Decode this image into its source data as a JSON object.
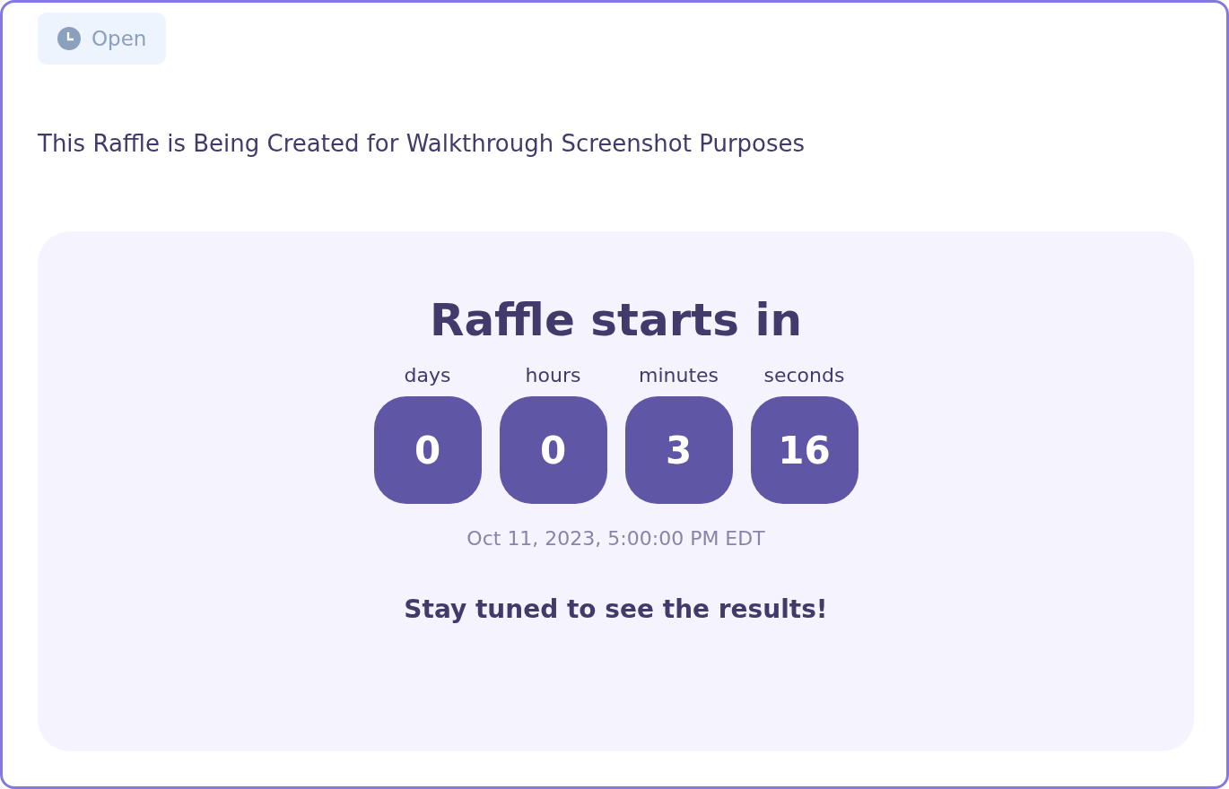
{
  "status_badge": {
    "label": "Open"
  },
  "title": "This Raffle is Being Created for Walkthrough Screenshot Purposes",
  "countdown": {
    "heading": "Raffle starts in",
    "units": [
      {
        "label": "days",
        "value": "0"
      },
      {
        "label": "hours",
        "value": "0"
      },
      {
        "label": "minutes",
        "value": "3"
      },
      {
        "label": "seconds",
        "value": "16"
      }
    ],
    "date": "Oct 11, 2023, 5:00:00 PM EDT",
    "message": "Stay tuned to see the results!"
  }
}
